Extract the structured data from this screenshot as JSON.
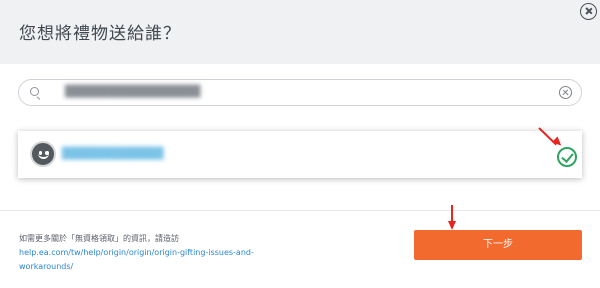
{
  "header": {
    "title": "您想將禮物送給誰？"
  },
  "search": {
    "value": "████████████████"
  },
  "result": {
    "username": "████████████"
  },
  "footer": {
    "info_text": "如需更多關於「無資格領取」的資訊，請造訪",
    "link": "help.ea.com/tw/help/origin/origin/origin-gifting-issues-and-workarounds/"
  },
  "actions": {
    "next_label": "下一步"
  },
  "colors": {
    "accent": "#f26a2e",
    "check": "#2ea562",
    "annotation_arrow": "#e8251f",
    "link": "#2a86d1"
  }
}
